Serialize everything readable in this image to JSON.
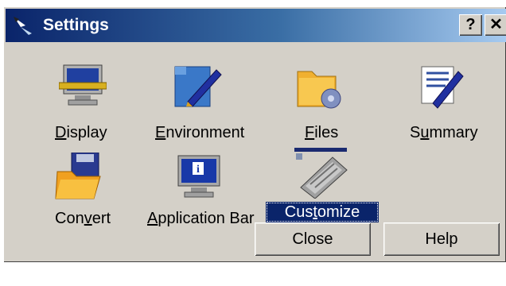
{
  "window": {
    "title": "Settings",
    "help_glyph": "?",
    "close_glyph": "✕"
  },
  "items": [
    {
      "name": "display",
      "label_pre": "",
      "label_key": "D",
      "label_post": "isplay",
      "icon": "monitor-icon"
    },
    {
      "name": "environment",
      "label_pre": "",
      "label_key": "E",
      "label_post": "nvironment",
      "icon": "environment-icon"
    },
    {
      "name": "files",
      "label_pre": "",
      "label_key": "F",
      "label_post": "iles",
      "icon": "folder-icon"
    },
    {
      "name": "summary",
      "label_pre": "S",
      "label_key": "u",
      "label_post": "mmary",
      "icon": "summary-icon"
    },
    {
      "name": "convert",
      "label_pre": "Con",
      "label_key": "v",
      "label_post": "ert",
      "icon": "convert-icon"
    },
    {
      "name": "application-bar",
      "label_pre": "",
      "label_key": "A",
      "label_post": "pplication Bar",
      "icon": "application-bar-icon"
    },
    {
      "name": "customize",
      "label_pre": "Cus",
      "label_key": "t",
      "label_post": "omize",
      "icon": "keyboard-icon",
      "selected": true
    }
  ],
  "buttons": {
    "close": "Close",
    "help": "Help"
  }
}
